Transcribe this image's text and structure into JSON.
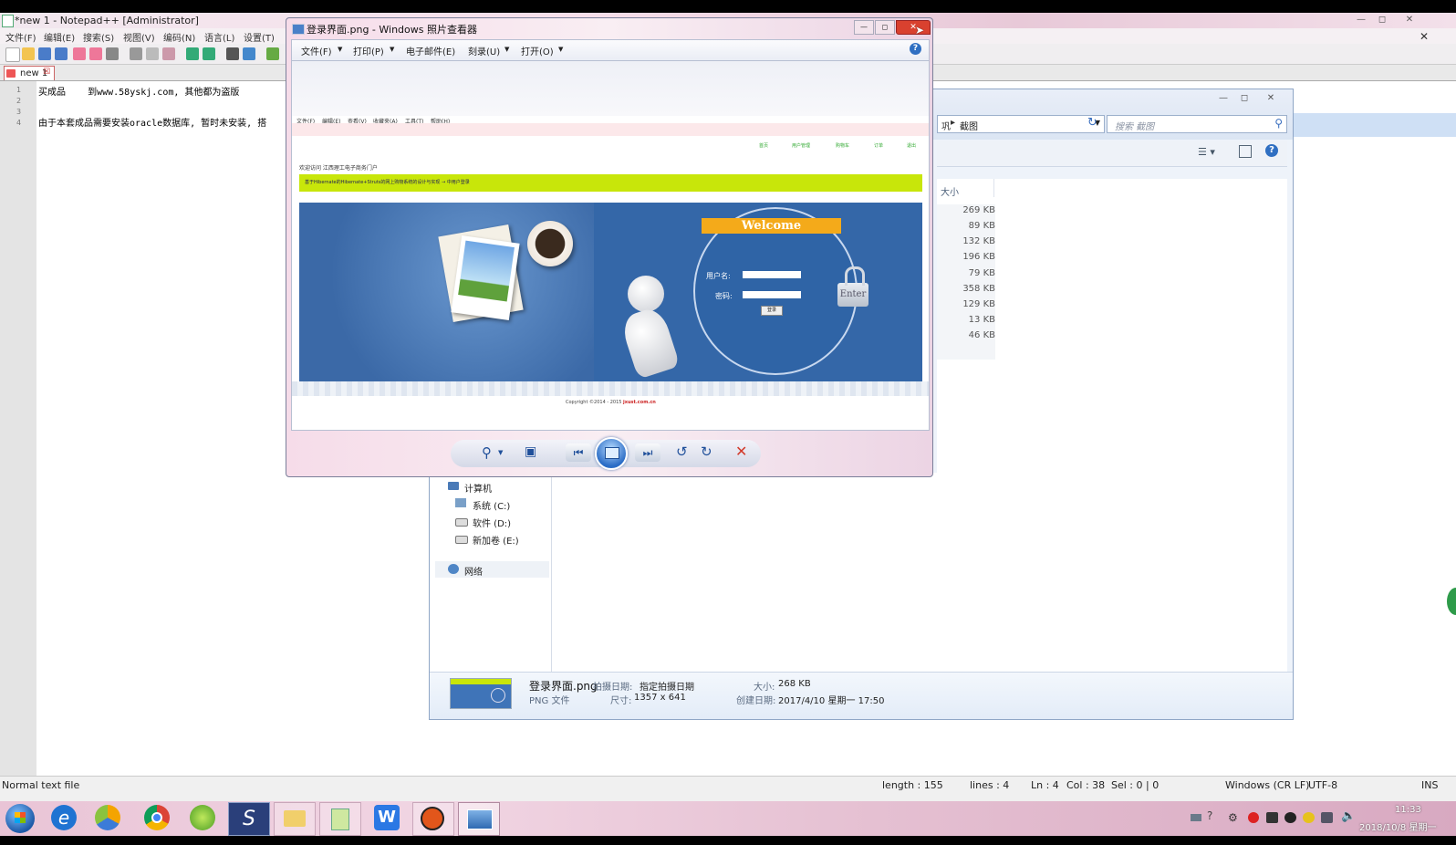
{
  "notepad": {
    "title": "*new 1 - Notepad++ [Administrator]",
    "menu": [
      "文件(F)",
      "编辑(E)",
      "搜索(S)",
      "视图(V)",
      "编码(N)",
      "语言(L)",
      "设置(T)"
    ],
    "tab": "new 1",
    "line_numbers": [
      "1",
      "2",
      "3",
      "4"
    ],
    "lines": [
      "买成品    到www.58yskj.com, 其他都为盗版",
      "",
      "",
      "由于本套成品需要安装oracle数据库, 暂时未安装, 搭"
    ],
    "status": {
      "file_type": "Normal text file",
      "length": "length : 155",
      "lines": "lines : 4",
      "ln": "Ln : 4",
      "col": "Col : 38",
      "sel": "Sel : 0 | 0",
      "eol": "Windows (CR LF)",
      "encoding": "UTF-8",
      "mode": "INS"
    }
  },
  "explorer": {
    "breadcrumb": "截图",
    "breadcrumb_prefix": "巩",
    "search_placeholder": "搜索 截图",
    "column_size": "大小",
    "sizes": [
      "269 KB",
      "89 KB",
      "132 KB",
      "196 KB",
      "79 KB",
      "358 KB",
      "129 KB",
      "13 KB",
      "46 KB"
    ],
    "nav": {
      "computer": "计算机",
      "drive_c": "系统 (C:)",
      "drive_d": "软件 (D:)",
      "drive_e": "新加卷 (E:)",
      "network": "网络"
    },
    "details": {
      "filename": "登录界面.png",
      "date_taken_label": "拍摄日期:",
      "date_taken_value": "指定拍摄日期",
      "size_label": "大小:",
      "size_value": "268 KB",
      "type": "PNG 文件",
      "dimensions_label": "尺寸:",
      "dimensions_value": "1357 x 641",
      "created_label": "创建日期:",
      "created_value": "2017/4/10 星期一 17:50"
    }
  },
  "viewer": {
    "title": "登录界面.png - Windows 照片查看器",
    "menu": [
      "文件(F)",
      "打印(P)",
      "电子邮件(E)",
      "刻录(U)",
      "打开(O)"
    ],
    "image": {
      "menu": [
        "文件(F)",
        "编辑(E)",
        "查看(V)",
        "收藏夹(A)",
        "工具(T)",
        "帮助(H)"
      ],
      "links": [
        "首页",
        "用户管理",
        "购物车",
        "订单",
        "退出"
      ],
      "welcome_line": "欢迎访问 江西理工电子商务门户",
      "green_bar": "基于Hibernate的Hibernate+Struts的网上购物系统的设计与实现 → 中用户登录",
      "welcome": "Welcome",
      "username_label": "用户名:",
      "password_label": "密码:",
      "login_btn": "登录",
      "enter": "Enter",
      "copyright": "Copyright ©2014 - 2015",
      "copyright_brand": "jxust.com.cn"
    }
  },
  "taskbar": {
    "time": "11:33",
    "date": "2018/10/8 星期一"
  },
  "colors": {
    "notepad_title": "#f7dfea",
    "viewer_frame": "#f6dce9",
    "banner_blue": "#3467a8",
    "welcome_orange": "#f4aa1a",
    "green_bar": "#c8e60a",
    "close_red": "#d9412f"
  }
}
